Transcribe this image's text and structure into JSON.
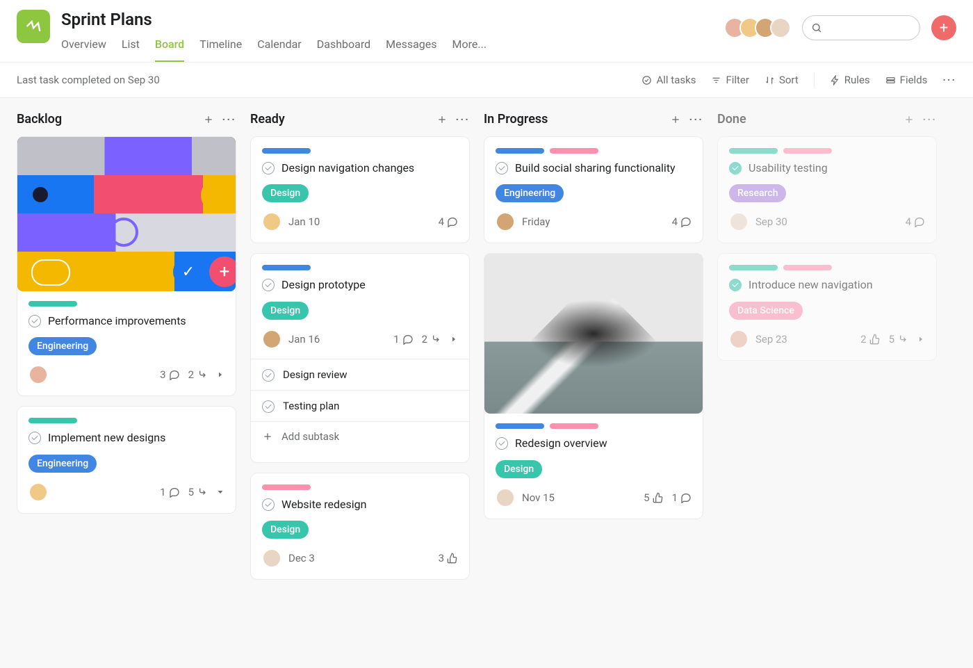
{
  "project": {
    "title": "Sprint Plans",
    "icon_glyph": "↯"
  },
  "tabs": [
    "Overview",
    "List",
    "Board",
    "Timeline",
    "Calendar",
    "Dashboard",
    "Messages",
    "More..."
  ],
  "active_tab": "Board",
  "status_line": "Last task completed on Sep 30",
  "toolbar": {
    "all_tasks": "All tasks",
    "filter": "Filter",
    "sort": "Sort",
    "rules": "Rules",
    "fields": "Fields"
  },
  "columns": [
    {
      "name": "Backlog",
      "cards": [
        {
          "cover": "art",
          "pills": [
            "teal"
          ],
          "title": "Performance improvements",
          "tag": "Engineering",
          "tag_class": "eng",
          "date": null,
          "stats": {
            "comments": 3,
            "subtasks": 2,
            "chevron": "right"
          }
        },
        {
          "pills": [
            "teal"
          ],
          "title": "Implement new designs",
          "tag": "Engineering",
          "tag_class": "eng",
          "date": null,
          "stats": {
            "comments": 1,
            "subtasks": 5,
            "chevron": "down"
          }
        }
      ]
    },
    {
      "name": "Ready",
      "cards": [
        {
          "pills": [
            "blue"
          ],
          "title": "Design navigation changes",
          "tag": "Design",
          "tag_class": "design",
          "date": "Jan 10",
          "stats": {
            "comments": 4
          }
        },
        {
          "pills": [
            "blue"
          ],
          "title": "Design prototype",
          "tag": "Design",
          "tag_class": "design",
          "date": "Jan 16",
          "stats": {
            "comments": 1,
            "subtasks": 2,
            "chevron": "right"
          },
          "subtasks": [
            {
              "title": "Design review"
            },
            {
              "title": "Testing plan"
            }
          ],
          "add_subtask_label": "Add subtask"
        },
        {
          "pills": [
            "pink"
          ],
          "title": "Website redesign",
          "tag": "Design",
          "tag_class": "design",
          "date": "Dec 3",
          "stats": {
            "likes": 3
          }
        }
      ]
    },
    {
      "name": "In Progress",
      "cards": [
        {
          "pills": [
            "blue",
            "pink"
          ],
          "title": "Build social sharing functionality",
          "tag": "Engineering",
          "tag_class": "eng",
          "date": "Friday",
          "stats": {
            "comments": 4
          }
        },
        {
          "cover": "mountain",
          "pills": [
            "blue",
            "pink"
          ],
          "title": "Redesign overview",
          "tag": "Design",
          "tag_class": "design",
          "date": "Nov 15",
          "stats": {
            "likes": 5,
            "comments": 1
          }
        }
      ]
    },
    {
      "name": "Done",
      "faded": true,
      "cards": [
        {
          "pills": [
            "teal",
            "pink"
          ],
          "done": true,
          "title": "Usability testing",
          "tag": "Research",
          "tag_class": "research",
          "date": "Sep 30",
          "stats": {
            "comments": 4
          }
        },
        {
          "pills": [
            "teal",
            "pink"
          ],
          "done": true,
          "title": "Introduce new navigation",
          "tag": "Data Science",
          "tag_class": "ds",
          "date": "Sep 23",
          "stats": {
            "likes": 2,
            "subtasks": 5,
            "chevron": "right"
          }
        }
      ]
    }
  ],
  "avatar_colors": [
    "#e8b4a0",
    "#f0c987",
    "#d4a574",
    "#e8d5c4"
  ]
}
